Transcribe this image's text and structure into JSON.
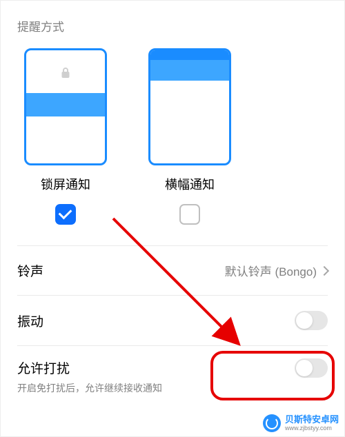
{
  "section_title": "提醒方式",
  "options": {
    "lockscreen": {
      "label": "锁屏通知",
      "checked": true
    },
    "banner": {
      "label": "横幅通知",
      "checked": false
    }
  },
  "rows": {
    "ringtone": {
      "label": "铃声",
      "value": "默认铃声 (Bongo)"
    },
    "vibration": {
      "label": "振动",
      "on": false
    },
    "allow_disturb": {
      "label": "允许打扰",
      "sub": "开启免打扰后，允许继续接收通知",
      "on": false
    }
  },
  "watermark": {
    "main": "贝斯特安卓网",
    "sub": "www.zjbstyy.com"
  }
}
